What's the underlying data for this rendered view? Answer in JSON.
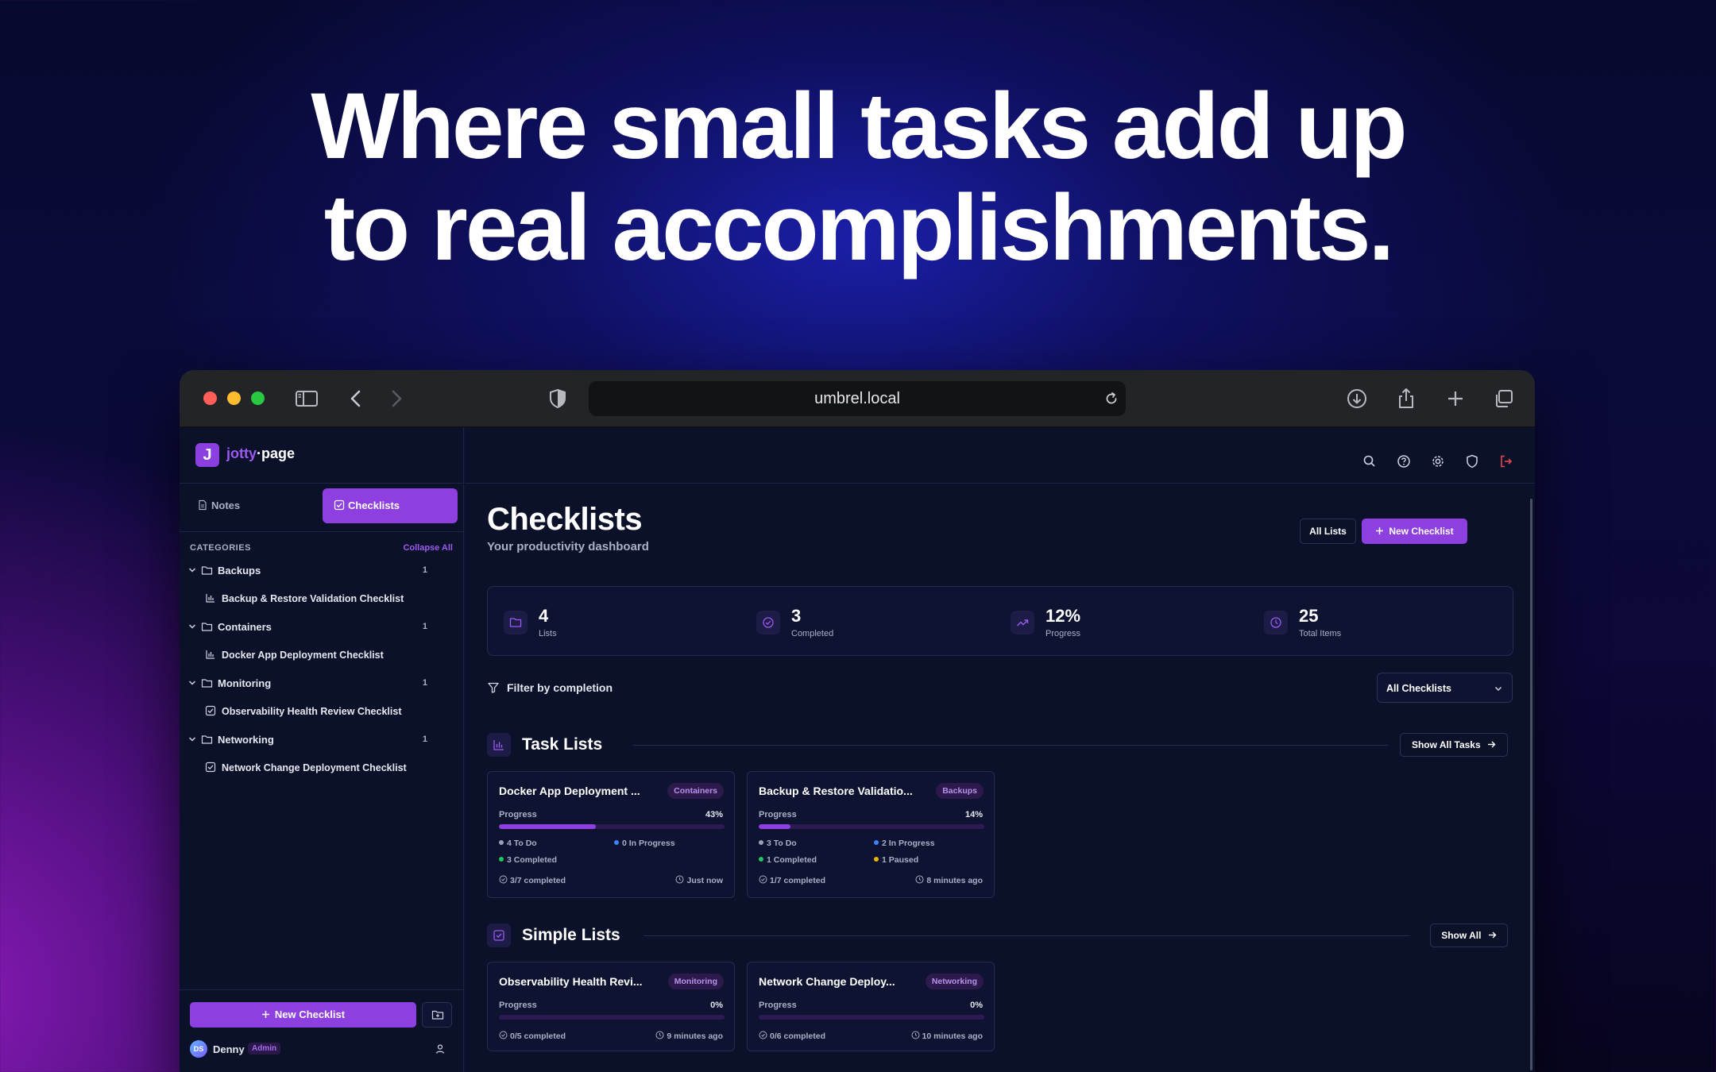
{
  "hero": {
    "line1": "Where small tasks add up",
    "line2": "to real accomplishments."
  },
  "browser": {
    "url": "umbrel.local"
  },
  "app": {
    "logo_letter": "J",
    "logo_accent": "jotty",
    "logo_rest": "·page",
    "tabs": [
      {
        "label": "Notes"
      },
      {
        "label": "Checklists"
      }
    ],
    "categories_heading": "CATEGORIES",
    "collapse_all": "Collapse All",
    "categories": [
      {
        "name": "Backups",
        "count": "1",
        "item": "Backup & Restore Validation Checklist",
        "item_icon": "bar-chart-icon"
      },
      {
        "name": "Containers",
        "count": "1",
        "item": "Docker App Deployment Checklist",
        "item_icon": "bar-chart-icon"
      },
      {
        "name": "Monitoring",
        "count": "1",
        "item": "Observability Health Review Checklist",
        "item_icon": "checkbox-icon"
      },
      {
        "name": "Networking",
        "count": "1",
        "item": "Network Change Deployment Checklist",
        "item_icon": "checkbox-icon"
      }
    ],
    "sidebar_new_button": "New Checklist",
    "user": {
      "initials": "DS",
      "name": "Denny",
      "role": "Admin"
    }
  },
  "main": {
    "title": "Checklists",
    "subtitle": "Your productivity dashboard",
    "all_lists_button": "All Lists",
    "new_checklist_button": "New Checklist",
    "stats": [
      {
        "value": "4",
        "label": "Lists",
        "icon": "folder-icon"
      },
      {
        "value": "3",
        "label": "Completed",
        "icon": "check-circle-icon"
      },
      {
        "value": "12%",
        "label": "Progress",
        "icon": "trending-up-icon"
      },
      {
        "value": "25",
        "label": "Total Items",
        "icon": "clock-icon"
      }
    ],
    "filter_label": "Filter by completion",
    "filter_select": "All Checklists",
    "task_lists": {
      "title": "Task Lists",
      "button": "Show All Tasks",
      "cards": [
        {
          "title": "Docker App Deployment ...",
          "badge": "Containers",
          "progress_label": "Progress",
          "progress_text": "43%",
          "progress": 0.43,
          "todo": "4 To Do",
          "in_progress": "0 In Progress",
          "completed": "3 Completed",
          "paused": "",
          "summary": "3/7 completed",
          "time": "Just now"
        },
        {
          "title": "Backup & Restore Validatio...",
          "badge": "Backups",
          "progress_label": "Progress",
          "progress_text": "14%",
          "progress": 0.14,
          "todo": "3 To Do",
          "in_progress": "2 In Progress",
          "completed": "1 Completed",
          "paused": "1 Paused",
          "summary": "1/7 completed",
          "time": "8 minutes ago"
        }
      ]
    },
    "simple_lists": {
      "title": "Simple Lists",
      "button": "Show All",
      "cards": [
        {
          "title": "Observability Health Revi...",
          "badge": "Monitoring",
          "progress_label": "Progress",
          "progress_text": "0%",
          "progress": 0,
          "summary": "0/5 completed",
          "time": "9 minutes ago"
        },
        {
          "title": "Network Change Deploy...",
          "badge": "Networking",
          "progress_label": "Progress",
          "progress_text": "0%",
          "progress": 0,
          "summary": "0/6 completed",
          "time": "10 minutes ago"
        }
      ]
    }
  },
  "colors": {
    "accent": "#8d3fdf",
    "dot_todo": "#9aa0b4",
    "dot_in_progress": "#3b82f6",
    "dot_completed": "#22c55e",
    "dot_paused": "#eab308",
    "logout": "#e5484d"
  }
}
